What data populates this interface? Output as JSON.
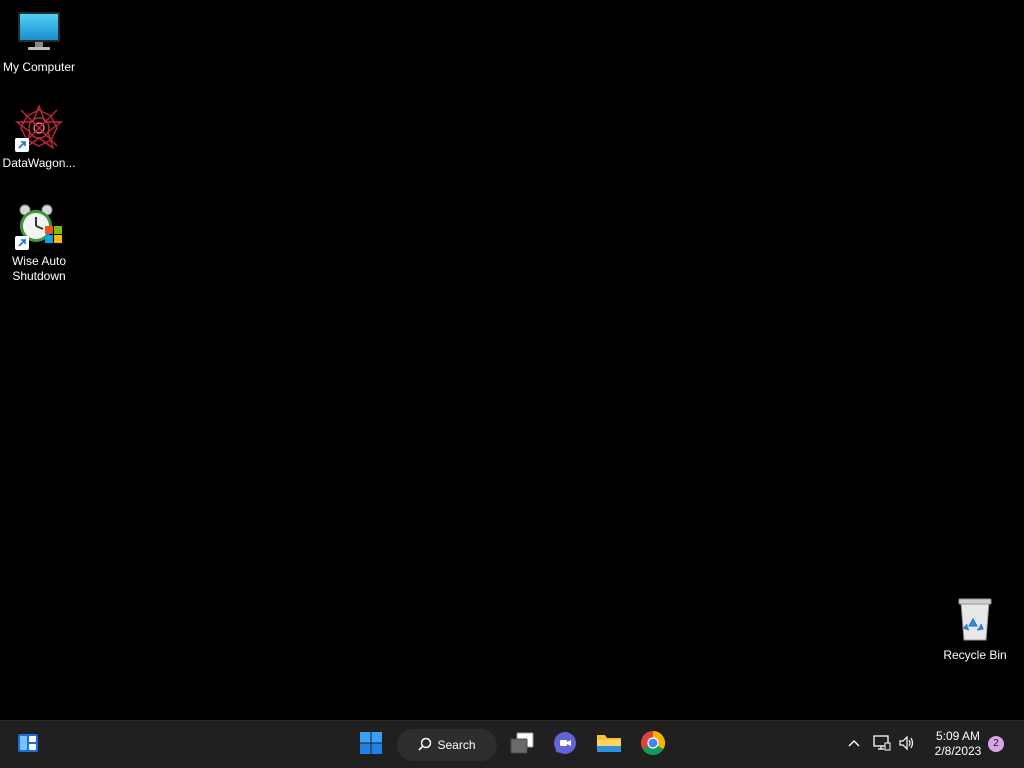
{
  "desktop": {
    "icons": [
      {
        "label": "My Computer",
        "icon": "monitor-icon",
        "shortcut": false
      },
      {
        "label": "DataWagon...",
        "icon": "datawagon-icon",
        "shortcut": true
      },
      {
        "label": "Wise Auto\nShutdown",
        "icon": "alarm-clock-icon",
        "shortcut": true
      },
      {
        "label": "Recycle Bin",
        "icon": "recycle-bin-icon",
        "shortcut": false
      }
    ]
  },
  "taskbar": {
    "widgets_icon": "widgets-icon",
    "start_icon": "windows-logo-icon",
    "search_label": "Search",
    "pinned": [
      {
        "icon": "task-view-icon"
      },
      {
        "icon": "teams-chat-icon"
      },
      {
        "icon": "file-explorer-icon"
      },
      {
        "icon": "chrome-icon"
      }
    ],
    "tray": {
      "chevron_icon": "chevron-up-icon",
      "network_icon": "network-icon",
      "volume_icon": "volume-icon",
      "time": "5:09 AM",
      "date": "2/8/2023",
      "notification_count": "2"
    }
  },
  "colors": {
    "desktop_bg": "#000000",
    "taskbar_bg": "#202020",
    "accent": "#0078d4"
  }
}
